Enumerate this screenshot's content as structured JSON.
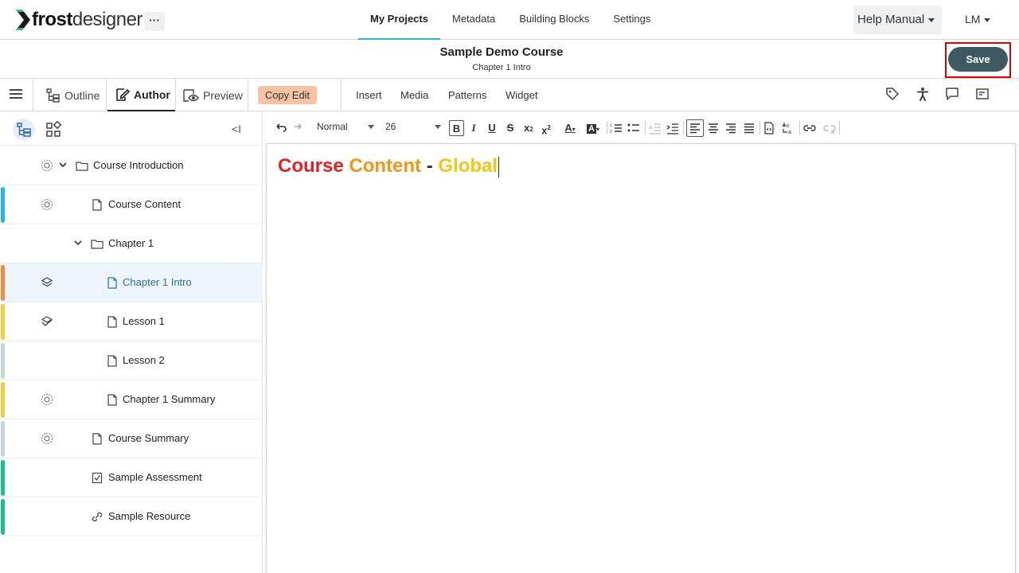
{
  "brand": {
    "name_bold": "frost",
    "name_light": "designer",
    "more_label": "···"
  },
  "topnav": {
    "tabs": [
      {
        "label": "My Projects",
        "active": true
      },
      {
        "label": "Metadata"
      },
      {
        "label": "Building Blocks"
      },
      {
        "label": "Settings"
      }
    ],
    "help_label": "Help Manual",
    "user_label": "LM"
  },
  "titlebar": {
    "title": "Sample Demo Course",
    "subtitle": "Chapter 1 Intro",
    "save_label": "Save"
  },
  "modebar": {
    "tabs": [
      {
        "label": "Outline",
        "icon": "outline-icon"
      },
      {
        "label": "Author",
        "icon": "author-icon",
        "active": true
      },
      {
        "label": "Preview",
        "icon": "preview-icon"
      }
    ],
    "copy_edit_label": "Copy Edit",
    "links": [
      "Insert",
      "Media",
      "Patterns",
      "Widget"
    ],
    "right_icons": [
      "tag-icon",
      "accessibility-icon",
      "comment-icon",
      "notes-icon"
    ]
  },
  "sidebar": {
    "collapse_label": "<I",
    "items": [
      {
        "label": "Course Introduction",
        "type": "folder",
        "status": "gear"
      },
      {
        "label": "Course Content",
        "type": "page",
        "status": "gear",
        "accent": "#2ab4e6"
      },
      {
        "label": "Chapter 1",
        "type": "folder"
      },
      {
        "label": "Chapter 1 Intro",
        "type": "page",
        "status": "layers",
        "accent": "#f08a4b",
        "selected": true
      },
      {
        "label": "Lesson 1",
        "type": "page",
        "status": "layers-check",
        "accent": "#f7c948"
      },
      {
        "label": "Lesson 2",
        "type": "page",
        "accent": "#c7d6da"
      },
      {
        "label": "Chapter 1 Summary",
        "type": "page",
        "status": "gear",
        "accent": "#f7c948"
      },
      {
        "label": "Course Summary",
        "type": "page",
        "status": "gear",
        "accent": "#c7d6da"
      },
      {
        "label": "Sample Assessment",
        "type": "assessment",
        "accent": "#1dbf8a"
      },
      {
        "label": "Sample Resource",
        "type": "resource",
        "accent": "#1dbf8a"
      }
    ]
  },
  "editor": {
    "style_value": "Normal",
    "size_value": "26",
    "heading": {
      "w1": "Course",
      "w2": "Content",
      "w3": "-",
      "w4": "Global"
    }
  }
}
